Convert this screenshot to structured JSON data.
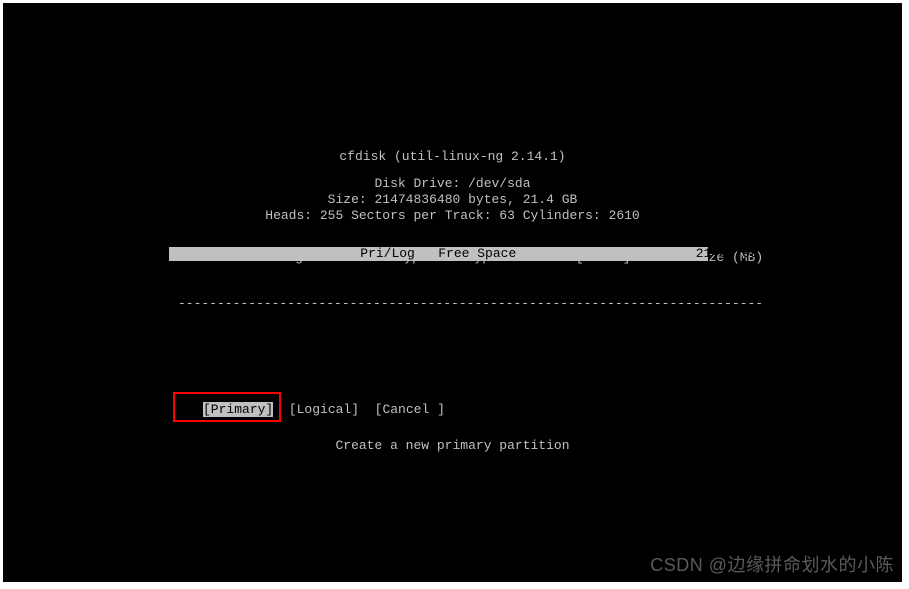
{
  "terminal": {
    "title": "cfdisk (util-linux-ng 2.14.1)",
    "disk_drive_line": "Disk Drive: /dev/sda",
    "size_line": "Size: 21474836480 bytes, 21.4 GB",
    "geometry_line": "Heads: 255   Sectors per Track: 63   Cylinders: 2610"
  },
  "table": {
    "headers": {
      "name": "Name",
      "flags": "Flags",
      "part_type": "Part Type",
      "fs_type": "FS Type",
      "label": "[Label]",
      "size": "Size (MB)"
    },
    "divider": "---------------------------------------------------------------------------",
    "row": {
      "part_type": "Pri/Log",
      "fs_type": "Free Space",
      "size": "21467.99"
    }
  },
  "menu": {
    "primary": "[Primary]",
    "logical": "[Logical]",
    "cancel": "[Cancel ]"
  },
  "hint": "Create a new primary partition",
  "watermark": "CSDN @边缘拼命划水的小陈"
}
